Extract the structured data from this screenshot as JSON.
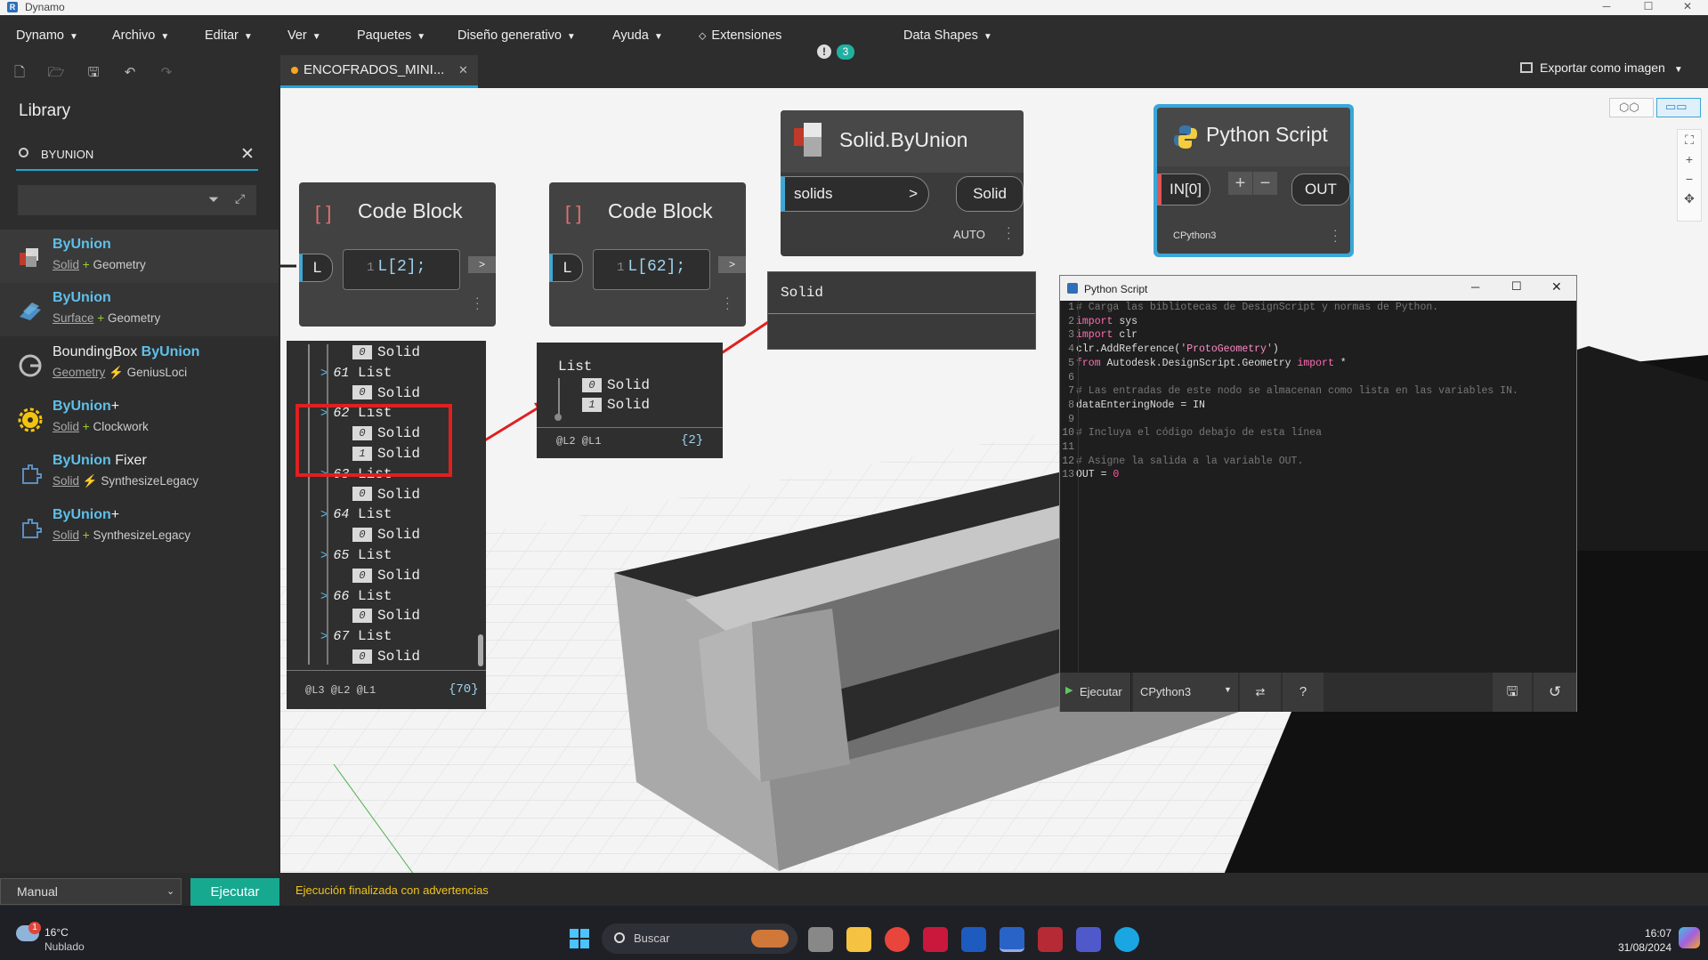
{
  "window": {
    "title": "Dynamo",
    "min": "─",
    "max": "☐",
    "close": "✕"
  },
  "menu": [
    {
      "label": "Dynamo"
    },
    {
      "label": "Archivo"
    },
    {
      "label": "Editar"
    },
    {
      "label": "Ver"
    },
    {
      "label": "Paquetes"
    },
    {
      "label": "Diseño generativo"
    },
    {
      "label": "Ayuda"
    },
    {
      "label": "Extensiones"
    },
    {
      "label": "Data Shapes"
    }
  ],
  "notification_count": "3",
  "tab": {
    "label": "ENCOFRADOS_MINI...",
    "close": "✕"
  },
  "export_label": "Exportar como imagen",
  "library": {
    "title": "Library",
    "search_value": "BYUNION",
    "items": [
      {
        "name_hl": "ByUnion",
        "name_pre": "",
        "name_post": "",
        "cat": "Solid",
        "sep": "+",
        "pkg": "Geometry"
      },
      {
        "name_hl": "ByUnion",
        "name_pre": "",
        "name_post": "",
        "cat": "Surface",
        "sep": "+",
        "pkg": "Geometry"
      },
      {
        "name_hl": "ByUnion",
        "name_pre": "BoundingBox ",
        "name_post": "",
        "cat": "Geometry",
        "sep": "⚡",
        "pkg": "GeniusLoci"
      },
      {
        "name_hl": "ByUnion",
        "name_pre": "",
        "name_post": "+",
        "cat": "Solid",
        "sep": "+",
        "pkg": "Clockwork"
      },
      {
        "name_hl": "ByUnion",
        "name_pre": "",
        "name_post": " Fixer",
        "cat": "Solid",
        "sep": "⚡",
        "pkg": "SynthesizeLegacy"
      },
      {
        "name_hl": "ByUnion",
        "name_pre": "",
        "name_post": "+",
        "cat": "Solid",
        "sep": "+",
        "pkg": "SynthesizeLegacy"
      }
    ]
  },
  "nodes": {
    "cb1": {
      "title": "Code Block",
      "port": "L",
      "line": "1",
      "code": "L[2];",
      "out": ">"
    },
    "cb2": {
      "title": "Code Block",
      "port": "L",
      "line": "1",
      "code": "L[62];",
      "out": ">"
    },
    "union": {
      "title": "Solid.ByUnion",
      "in": "solids",
      "in_arrow": ">",
      "out": "Solid",
      "lacing": "AUTO"
    },
    "union_preview": "Solid",
    "python": {
      "title": "Python Script",
      "in": "IN[0]",
      "plus": "+",
      "minus": "−",
      "out": "OUT",
      "engine": "CPython3"
    }
  },
  "watch1": {
    "rows": [
      {
        "type": "item",
        "idx": "0",
        "label": "Solid",
        "lvl": 2
      },
      {
        "type": "list",
        "idx": "61",
        "label": "List"
      },
      {
        "type": "item",
        "idx": "0",
        "label": "Solid",
        "lvl": 2
      },
      {
        "type": "list",
        "idx": "62",
        "label": "List"
      },
      {
        "type": "item",
        "idx": "0",
        "label": "Solid",
        "lvl": 2
      },
      {
        "type": "item",
        "idx": "1",
        "label": "Solid",
        "lvl": 2
      },
      {
        "type": "list",
        "idx": "63",
        "label": "List"
      },
      {
        "type": "item",
        "idx": "0",
        "label": "Solid",
        "lvl": 2
      },
      {
        "type": "list",
        "idx": "64",
        "label": "List"
      },
      {
        "type": "item",
        "idx": "0",
        "label": "Solid",
        "lvl": 2
      },
      {
        "type": "list",
        "idx": "65",
        "label": "List"
      },
      {
        "type": "item",
        "idx": "0",
        "label": "Solid",
        "lvl": 2
      },
      {
        "type": "list",
        "idx": "66",
        "label": "List"
      },
      {
        "type": "item",
        "idx": "0",
        "label": "Solid",
        "lvl": 2
      },
      {
        "type": "list",
        "idx": "67",
        "label": "List"
      },
      {
        "type": "item",
        "idx": "0",
        "label": "Solid",
        "lvl": 2
      }
    ],
    "levels": "@L3 @L2 @L1",
    "count": "{70}"
  },
  "watch2": {
    "head": "List",
    "items": [
      {
        "idx": "0",
        "label": "Solid"
      },
      {
        "idx": "1",
        "label": "Solid"
      }
    ],
    "levels": "@L2 @L1",
    "count": "{2}"
  },
  "equals_sign": "=",
  "python_editor": {
    "title": "Python Script",
    "lines": [
      {
        "n": "1",
        "parts": [
          {
            "c": "cm",
            "t": "# Carga las bibliotecas de DesignScript y normas de Python."
          }
        ]
      },
      {
        "n": "2",
        "parts": [
          {
            "c": "kw",
            "t": "import"
          },
          {
            "c": "",
            "t": " sys"
          }
        ]
      },
      {
        "n": "3",
        "parts": [
          {
            "c": "kw",
            "t": "import"
          },
          {
            "c": "",
            "t": " clr"
          }
        ]
      },
      {
        "n": "4",
        "parts": [
          {
            "c": "",
            "t": "clr.AddReference("
          },
          {
            "c": "st",
            "t": "'ProtoGeometry'"
          },
          {
            "c": "",
            "t": ")"
          }
        ]
      },
      {
        "n": "5",
        "parts": [
          {
            "c": "kw",
            "t": "from"
          },
          {
            "c": "",
            "t": " Autodesk.DesignScript.Geometry "
          },
          {
            "c": "kw",
            "t": "import"
          },
          {
            "c": "",
            "t": " *"
          }
        ]
      },
      {
        "n": "6",
        "parts": []
      },
      {
        "n": "7",
        "parts": [
          {
            "c": "cm",
            "t": "# Las entradas de este nodo se almacenan como lista en las variables IN."
          }
        ]
      },
      {
        "n": "8",
        "parts": [
          {
            "c": "",
            "t": "dataEnteringNode = IN"
          }
        ]
      },
      {
        "n": "9",
        "parts": []
      },
      {
        "n": "10",
        "parts": [
          {
            "c": "cm",
            "t": "# Incluya el código debajo de esta línea"
          }
        ]
      },
      {
        "n": "11",
        "parts": []
      },
      {
        "n": "12",
        "parts": [
          {
            "c": "cm",
            "t": "# Asigne la salida a la variable OUT."
          }
        ]
      },
      {
        "n": "13",
        "parts": [
          {
            "c": "",
            "t": "OUT = "
          },
          {
            "c": "nm0",
            "t": "0"
          }
        ]
      }
    ],
    "run_label": "Ejecutar",
    "engine": "CPython3"
  },
  "status": {
    "mode": "Manual",
    "run": "Ejecutar",
    "message": "Ejecución finalizada con advertencias"
  },
  "taskbar": {
    "temp": "16°C",
    "weather": "Nublado",
    "badge": "1",
    "search": "Buscar",
    "time": "16:07",
    "date": "31/08/2024"
  }
}
